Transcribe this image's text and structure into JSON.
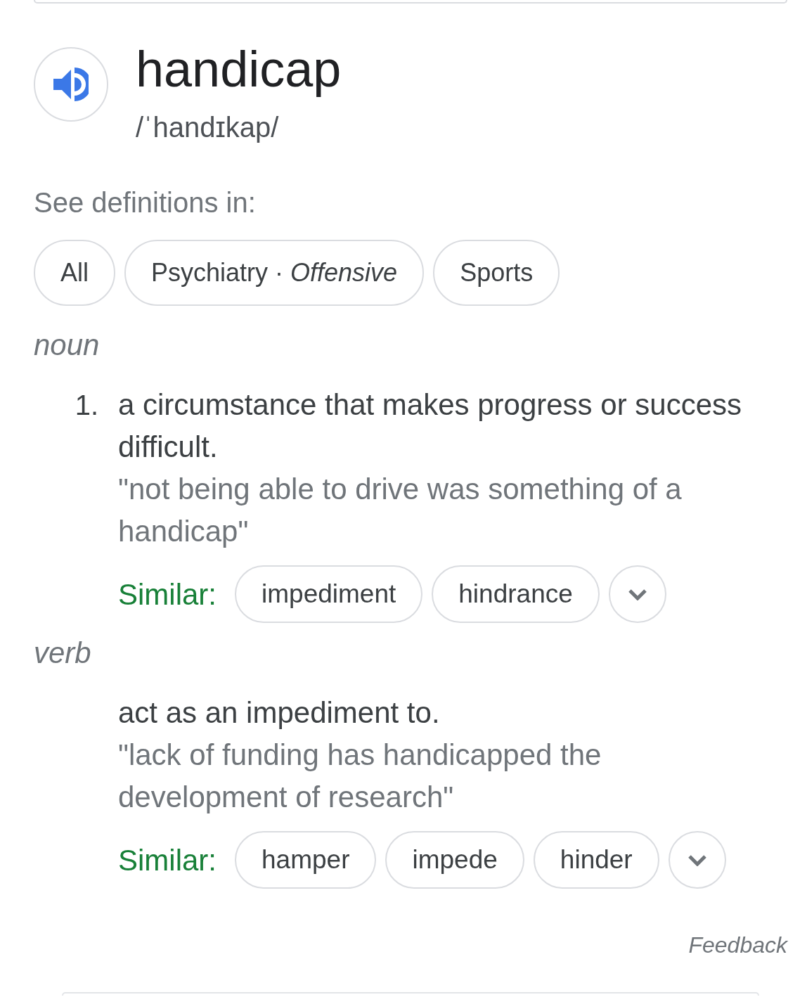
{
  "entry": {
    "word": "handicap",
    "pronunciation": "/ˈhandɪkap/"
  },
  "domains": {
    "label": "See definitions in:",
    "chips": [
      "All",
      "Psychiatry · *Offensive*",
      "Sports"
    ]
  },
  "senses": [
    {
      "part_of_speech": "noun",
      "definitions": [
        {
          "number": "1.",
          "text": "a circumstance that makes progress or success difficult.",
          "example": "\"not being able to drive was something of a handicap\"",
          "similar_label": "Similar:",
          "similar": [
            "impediment",
            "hindrance"
          ]
        }
      ]
    },
    {
      "part_of_speech": "verb",
      "definitions": [
        {
          "text": "act as an impediment to.",
          "example": "\"lack of funding has handicapped the development of research\"",
          "similar_label": "Similar:",
          "similar": [
            "hamper",
            "impede",
            "hinder"
          ]
        }
      ]
    }
  ],
  "feedback": "Feedback"
}
